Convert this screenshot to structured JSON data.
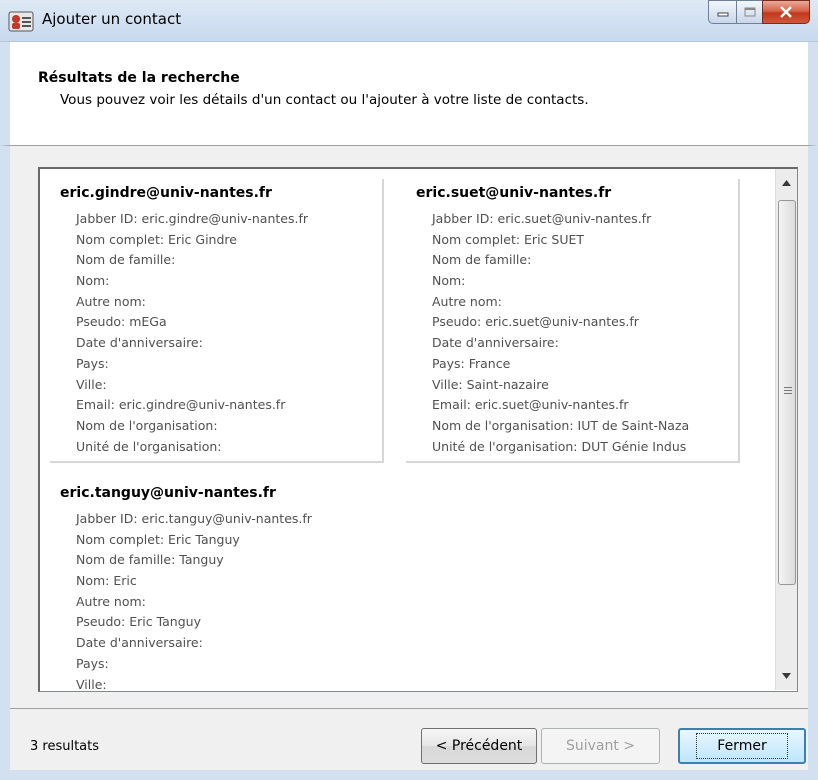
{
  "window": {
    "title": "Ajouter un contact"
  },
  "header": {
    "title": "Résultats de la recherche",
    "subtitle": "Vous pouvez voir les détails d'un contact ou l'ajouter à votre liste de contacts."
  },
  "results": [
    {
      "email": "eric.gindre@univ-nantes.fr",
      "fields": [
        "Jabber ID: eric.gindre@univ-nantes.fr",
        "Nom complet: Eric Gindre",
        "Nom de famille:",
        "Nom:",
        "Autre nom:",
        "Pseudo: mEGa",
        "Date d'anniversaire:",
        "Pays:",
        "Ville:",
        "Email: eric.gindre@univ-nantes.fr",
        "Nom de l'organisation:",
        "Unité de l'organisation:"
      ]
    },
    {
      "email": "eric.suet@univ-nantes.fr",
      "fields": [
        "Jabber ID: eric.suet@univ-nantes.fr",
        "Nom complet: Eric SUET",
        "Nom de famille:",
        "Nom:",
        "Autre nom:",
        "Pseudo: eric.suet@univ-nantes.fr",
        "Date d'anniversaire:",
        "Pays: France",
        "Ville: Saint-nazaire",
        "Email: eric.suet@univ-nantes.fr",
        "Nom de l'organisation: IUT de Saint-Naza",
        "Unité de l'organisation: DUT Génie Indus"
      ]
    },
    {
      "email": "eric.tanguy@univ-nantes.fr",
      "fields": [
        "Jabber ID: eric.tanguy@univ-nantes.fr",
        "Nom complet: Eric Tanguy",
        "Nom de famille: Tanguy",
        "Nom: Eric",
        "Autre nom:",
        "Pseudo: Eric Tanguy",
        "Date d'anniversaire:",
        "Pays:",
        "Ville:"
      ]
    }
  ],
  "footer": {
    "status": "3 resultats",
    "prev_label": "< Précédent",
    "next_label": "Suivant >",
    "close_label": "Fermer"
  },
  "colors": {
    "field_text": "#505050",
    "disabled_text": "#a0a0a0",
    "close_button_red": "#c1381c"
  },
  "icons": {
    "app": "contact-card-icon",
    "minimize": "minimize-icon",
    "maximize": "maximize-icon",
    "close": "close-icon",
    "scroll_up": "scroll-up-arrow-icon",
    "scroll_down": "scroll-down-arrow-icon"
  }
}
